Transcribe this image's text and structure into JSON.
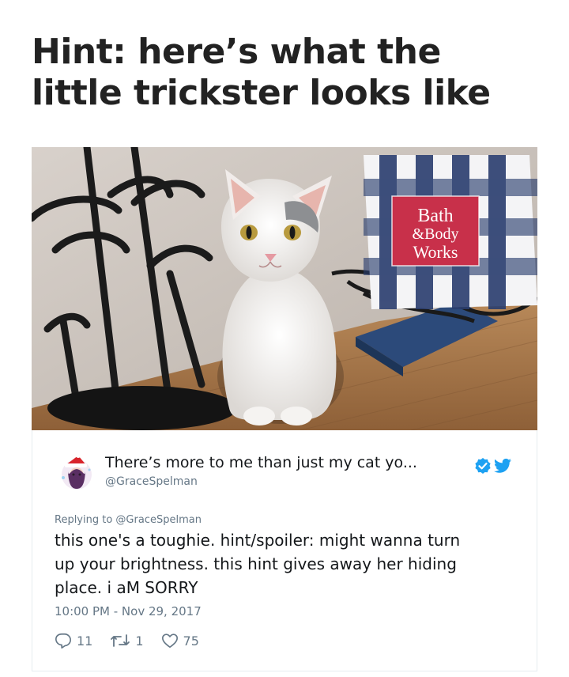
{
  "headline": {
    "line1": "Hint: here’s what the",
    "line2": "little trickster looks like"
  },
  "photo": {
    "bag_text": [
      "Bath",
      "&Body",
      "Works"
    ]
  },
  "tweet": {
    "display_name": "There’s more to me than just my cat yo...",
    "handle": "@GraceSpelman",
    "replying_to": "Replying to @GraceSpelman",
    "text_lines": [
      "this one's a toughie. hint/spoiler: might wanna turn",
      "up your brightness. this hint gives away her hiding",
      "place. i aM SORRY"
    ],
    "timestamp": "10:00 PM - Nov 29, 2017",
    "actions": {
      "replies": "11",
      "retweets": "1",
      "likes": "75"
    },
    "icons": {
      "verified": "verified-badge-icon",
      "bird": "twitter-bird-icon",
      "reply": "reply-icon",
      "retweet": "retweet-icon",
      "like": "heart-icon"
    },
    "colors": {
      "accent": "#1da1f2",
      "muted": "#657786",
      "text": "#14171a"
    }
  }
}
